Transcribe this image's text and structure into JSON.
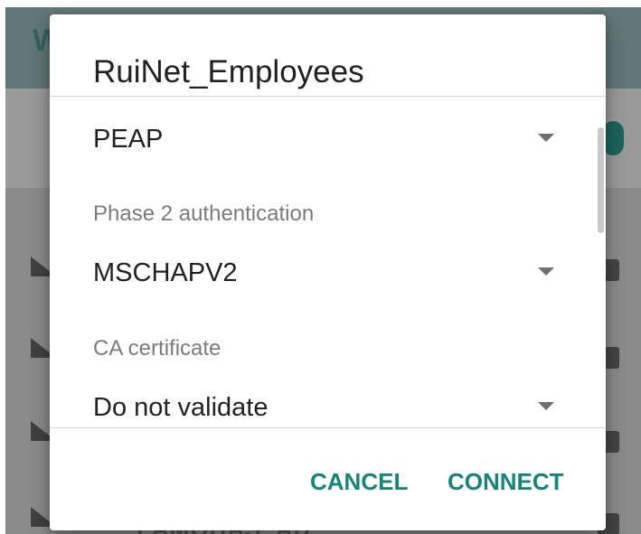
{
  "background": {
    "app_title_partial": "W",
    "bottom_network_partial": "LAMOHAS_AD",
    "colors": {
      "scrim": "#8b8b8b",
      "app_bar": "#3f6a66",
      "toggle_knob": "#0f5e57"
    },
    "icons": [
      "wifi-icon",
      "lock-icon",
      "toggle-knob"
    ]
  },
  "dialog": {
    "title": "RuiNet_Employees",
    "fields": {
      "eap_method": {
        "value": "PEAP",
        "icon": "dropdown-arrow-icon"
      },
      "phase_2_authentication": {
        "label": "Phase 2 authentication",
        "value": "MSCHAPV2",
        "icon": "dropdown-arrow-icon"
      },
      "ca_certificate": {
        "label": "CA certificate",
        "value": "Do not validate",
        "icon": "dropdown-arrow-icon"
      }
    },
    "actions": {
      "cancel": "CANCEL",
      "connect": "CONNECT"
    },
    "colors": {
      "surface": "#ffffff",
      "title_text": "#212121",
      "label_text": "#7b7b7b",
      "accent": "#14857a",
      "divider": "#d7d7d7",
      "scrollbar": "#c9c9c9"
    }
  }
}
